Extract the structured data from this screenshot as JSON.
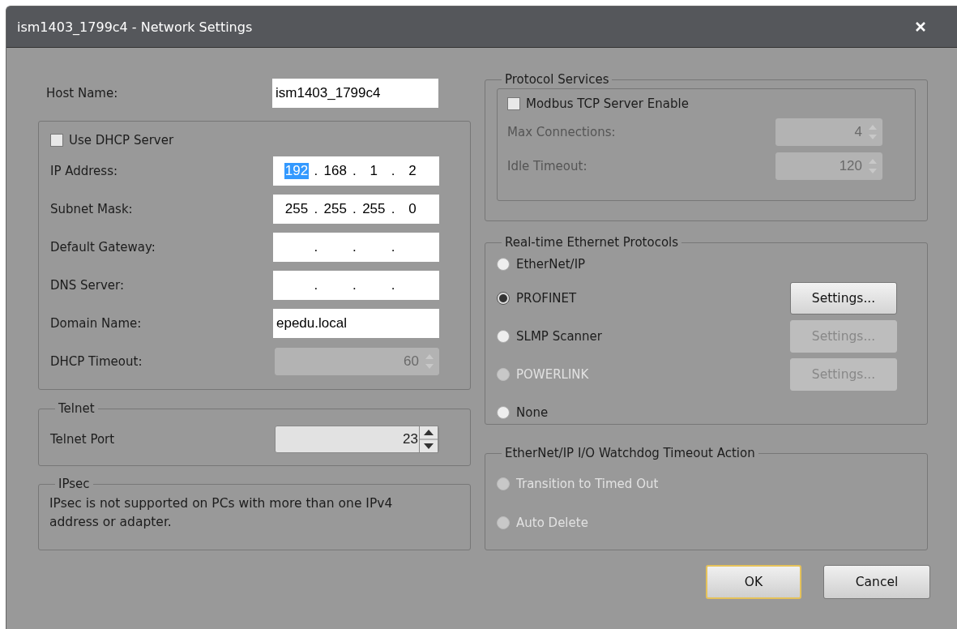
{
  "window": {
    "title": "ism1403_1799c4 - Network Settings"
  },
  "host_name": {
    "label": "Host Name:",
    "value": "ism1403_1799c4"
  },
  "dhcp_group": {
    "use_dhcp": {
      "label": "Use DHCP Server",
      "checked": false
    },
    "fields": [
      {
        "kind": "ip",
        "label": "IP Address:",
        "octets": [
          {
            "text": "192",
            "selected": true
          },
          {
            "text": "168",
            "selected": false
          },
          {
            "text": "1",
            "selected": false
          },
          {
            "text": "2",
            "selected": false
          }
        ],
        "separators": [
          ".",
          ".",
          "."
        ]
      },
      {
        "kind": "ip",
        "label": "Subnet Mask:",
        "octets": [
          {
            "text": "255",
            "selected": false
          },
          {
            "text": "255",
            "selected": false
          },
          {
            "text": "255",
            "selected": false
          },
          {
            "text": "0",
            "selected": false
          }
        ],
        "separators": [
          ".",
          ".",
          "."
        ]
      },
      {
        "kind": "ip",
        "label": "Default Gateway:",
        "separators": [
          ".",
          ".",
          "."
        ]
      },
      {
        "kind": "ip",
        "label": "DNS Server:",
        "separators": [
          ".",
          ".",
          "."
        ]
      },
      {
        "kind": "text",
        "label": "Domain Name:",
        "value": "epedu.local"
      },
      {
        "kind": "spin",
        "label": "DHCP Timeout:",
        "value": "60",
        "disabled": true
      }
    ]
  },
  "telnet": {
    "title": "Telnet",
    "port": {
      "label": "Telnet Port",
      "value": "23",
      "disabled": false
    }
  },
  "ipsec": {
    "title": "IPsec",
    "message": "IPsec is not supported on PCs with more than one IPv4 address or adapter."
  },
  "protocol_services": {
    "title": "Protocol Services",
    "modbus": {
      "label": "Modbus TCP Server Enable",
      "checked": false
    },
    "fields": [
      {
        "label": "Max Connections:",
        "value": "4",
        "disabled": true
      },
      {
        "label": "Idle Timeout:",
        "value": "120",
        "disabled": true
      }
    ]
  },
  "realtime": {
    "title": "Real-time Ethernet Protocols",
    "options": [
      {
        "label": "EtherNet/IP",
        "selected": false,
        "disabled": false
      },
      {
        "label": "PROFINET",
        "selected": true,
        "disabled": false,
        "settings": {
          "label": "Settings...",
          "disabled": false
        }
      },
      {
        "label": "SLMP Scanner",
        "selected": false,
        "disabled": false,
        "settings": {
          "label": "Settings...",
          "disabled": true
        }
      },
      {
        "label": "POWERLINK",
        "selected": false,
        "disabled": true,
        "settings": {
          "label": "Settings...",
          "disabled": true
        }
      },
      {
        "label": "None",
        "selected": false,
        "disabled": false
      }
    ]
  },
  "watchdog": {
    "title": "EtherNet/IP I/O Watchdog Timeout Action",
    "options": [
      {
        "label": "Transition to Timed Out",
        "selected": false,
        "disabled": true
      },
      {
        "label": "Auto Delete",
        "selected": false,
        "disabled": true
      }
    ]
  },
  "buttons": [
    {
      "label": "OK",
      "default": true
    },
    {
      "label": "Cancel",
      "default": false
    }
  ]
}
